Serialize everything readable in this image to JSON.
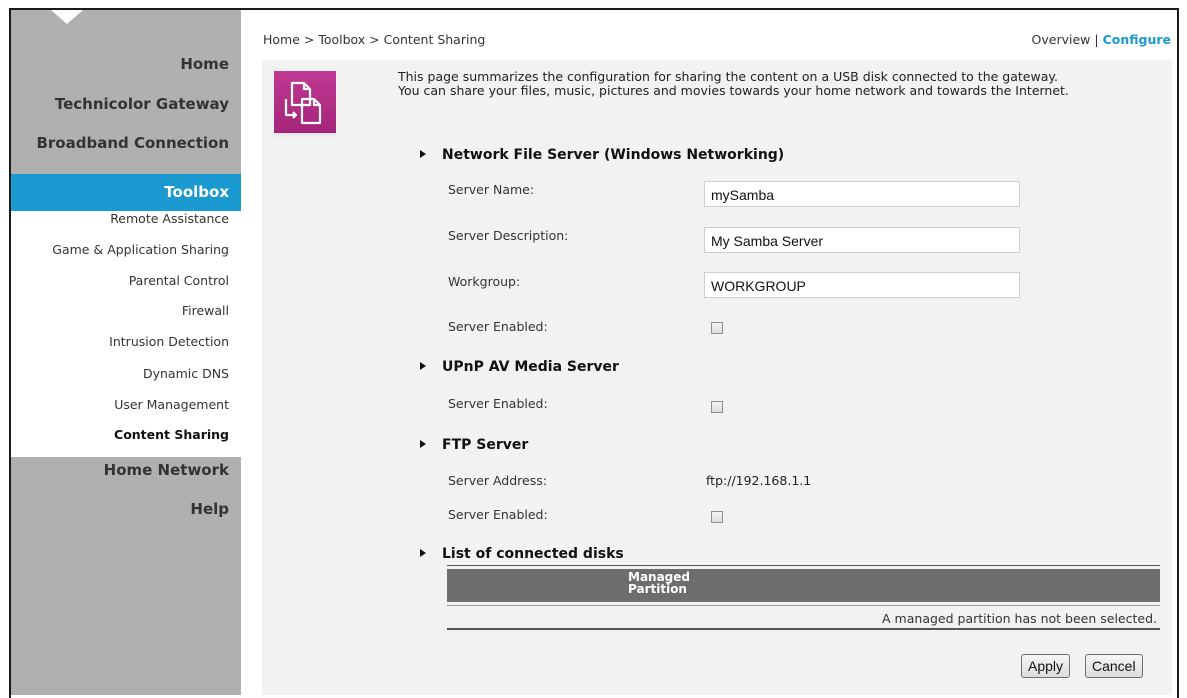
{
  "breadcrumb": "Home > Toolbox > Content Sharing",
  "topnav": {
    "overview": "Overview",
    "separator": "|",
    "configure": "Configure"
  },
  "sidebar": {
    "main": [
      "Home",
      "Technicolor Gateway",
      "Broadband Connection"
    ],
    "active": "Toolbox",
    "sub": [
      "Remote Assistance",
      "Game & Application Sharing",
      "Parental Control",
      "Firewall",
      "Intrusion Detection",
      "Dynamic DNS",
      "User Management",
      "Content Sharing"
    ],
    "after": [
      "Home Network",
      "Help"
    ]
  },
  "intro": {
    "line1": "This page summarizes the configuration for sharing the content on a USB disk connected to the gateway.",
    "line2": "You can share your files, music, pictures and movies towards your home network and towards the Internet."
  },
  "nfs": {
    "title": "Network File Server (Windows Networking)",
    "server_name_label": "Server Name:",
    "server_name_value": "mySamba",
    "server_desc_label": "Server Description:",
    "server_desc_value": "My Samba Server",
    "workgroup_label": "Workgroup:",
    "workgroup_value": "WORKGROUP",
    "enabled_label": "Server Enabled:",
    "enabled": false
  },
  "upnp": {
    "title": "UPnP AV Media Server",
    "enabled_label": "Server Enabled:",
    "enabled": false
  },
  "ftp": {
    "title": "FTP Server",
    "address_label": "Server Address:",
    "address_value": "ftp://192.168.1.1",
    "enabled_label": "Server Enabled:",
    "enabled": false
  },
  "disks": {
    "title": "List of connected disks",
    "col_line1": "Managed",
    "col_line2": "Partition",
    "message": "A managed partition has not been selected."
  },
  "buttons": {
    "apply": "Apply",
    "cancel": "Cancel"
  },
  "colors": {
    "accent": "#1a9ad0",
    "icon": "#b02e86",
    "sidebar": "#b0b0b0"
  }
}
